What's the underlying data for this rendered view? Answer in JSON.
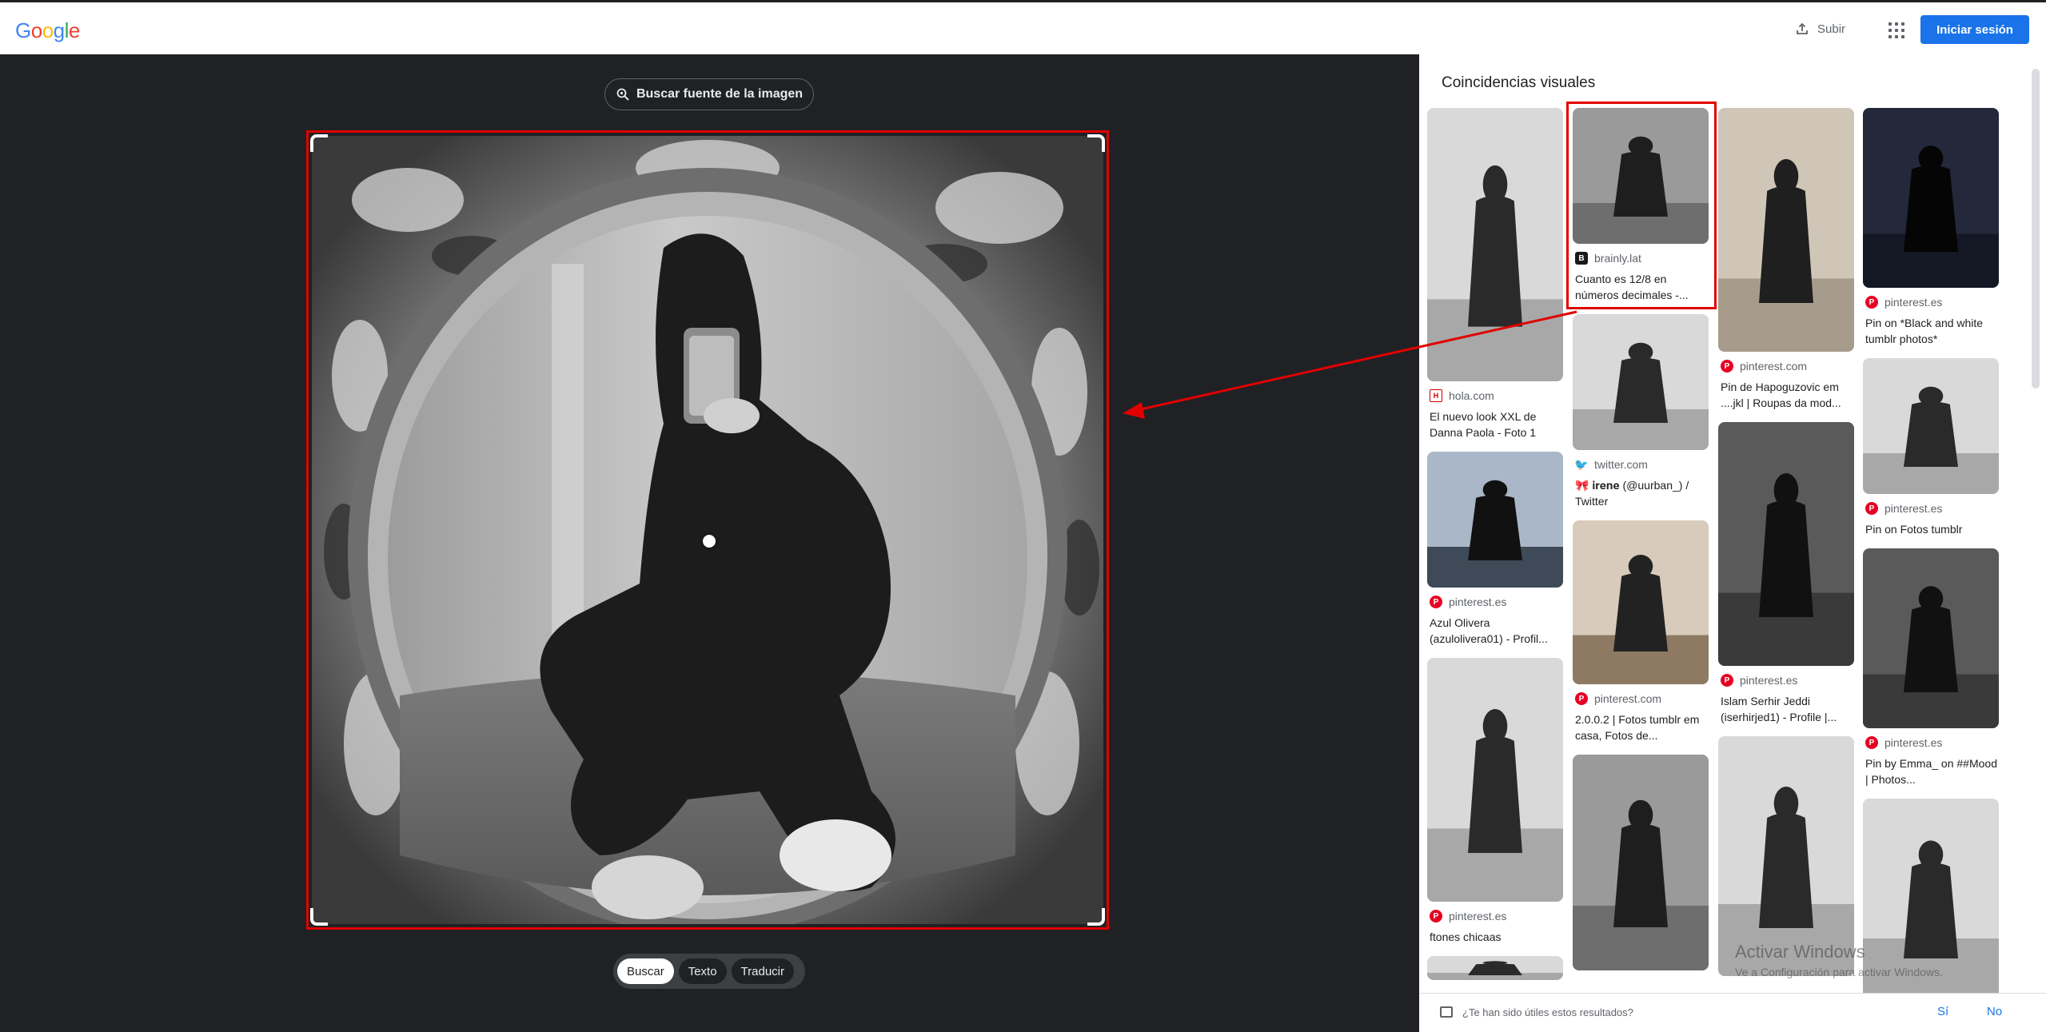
{
  "header": {
    "logo_letters": [
      {
        "ch": "G",
        "color": "#4285f4"
      },
      {
        "ch": "o",
        "color": "#ea4335"
      },
      {
        "ch": "o",
        "color": "#fbbc05"
      },
      {
        "ch": "g",
        "color": "#4285f4"
      },
      {
        "ch": "l",
        "color": "#34a853"
      },
      {
        "ch": "e",
        "color": "#ea4335"
      }
    ],
    "upload_label": "Subir",
    "signin_label": "Iniciar sesión"
  },
  "left": {
    "source_button": "Buscar fuente de la imagen",
    "modes": [
      "Buscar",
      "Texto",
      "Traducir"
    ],
    "active_mode": "Buscar"
  },
  "results": {
    "title": "Coincidencias visuales",
    "columns": [
      [
        {
          "source": "hola.com",
          "favicon": "hola",
          "title": "El nuevo look XXL de Danna Paola - Foto 1",
          "thumb_h": 342,
          "tone": "light"
        },
        {
          "source": "pinterest.es",
          "favicon": "pin",
          "title": "Azul Olivera (azulolivera01) - Profil...",
          "thumb_h": 170,
          "tone": "sky"
        },
        {
          "source": "pinterest.es",
          "favicon": "pin",
          "title": "ftones chicaas",
          "thumb_h": 305,
          "tone": "light"
        },
        {
          "source": "",
          "favicon": "",
          "title": "",
          "thumb_h": 30,
          "tone": "light"
        }
      ],
      [
        {
          "source": "brainly.lat",
          "favicon": "brainly",
          "title": "Cuanto es 12/8 en números decimales -...",
          "thumb_h": 170,
          "tone": "mid",
          "highlight": true
        },
        {
          "source": "twitter.com",
          "favicon": "tw",
          "title": "🎀 𝐢𝐫𝐞𝐧𝐞 (@uurban_) / Twitter",
          "thumb_h": 170,
          "tone": "light"
        },
        {
          "source": "pinterest.com",
          "favicon": "pin",
          "title": "2.0.0.2 | Fotos tumblr em casa, Fotos de...",
          "thumb_h": 205,
          "tone": "warm"
        },
        {
          "source": "",
          "favicon": "",
          "title": "",
          "thumb_h": 270,
          "tone": "mid"
        }
      ],
      [
        {
          "source": "pinterest.com",
          "favicon": "pin",
          "title": "Pin de Hapoguzovic em ....jkl | Roupas da mod...",
          "thumb_h": 305,
          "tone": "beige"
        },
        {
          "source": "pinterest.es",
          "favicon": "pin",
          "title": "Islam Serhir Jeddi (iserhirjed1) - Profile |...",
          "thumb_h": 305,
          "tone": "dark"
        },
        {
          "source": "",
          "favicon": "",
          "title": "",
          "thumb_h": 300,
          "tone": "light"
        }
      ],
      [
        {
          "source": "pinterest.es",
          "favicon": "pin",
          "title": "Pin on *Black and white tumblr photos*",
          "thumb_h": 225,
          "tone": "night"
        },
        {
          "source": "pinterest.es",
          "favicon": "pin",
          "title": "Pin on Fotos tumblr",
          "thumb_h": 170,
          "tone": "light"
        },
        {
          "source": "pinterest.es",
          "favicon": "pin",
          "title": "Pin by Emma_ on ##Mood | Photos...",
          "thumb_h": 225,
          "tone": "dark"
        },
        {
          "source": "",
          "favicon": "",
          "title": "",
          "thumb_h": 250,
          "tone": "light"
        }
      ]
    ],
    "feedback_question": "¿Te han sido útiles estos resultados?",
    "feedback_yes": "Sí",
    "feedback_no": "No"
  },
  "watermark": {
    "line1": "Activar Windows",
    "line2": "Ve a Configuración para activar Windows."
  },
  "colors": {
    "accent": "#1a73e8",
    "annotation": "#e10000",
    "dark_bg": "#202124"
  }
}
